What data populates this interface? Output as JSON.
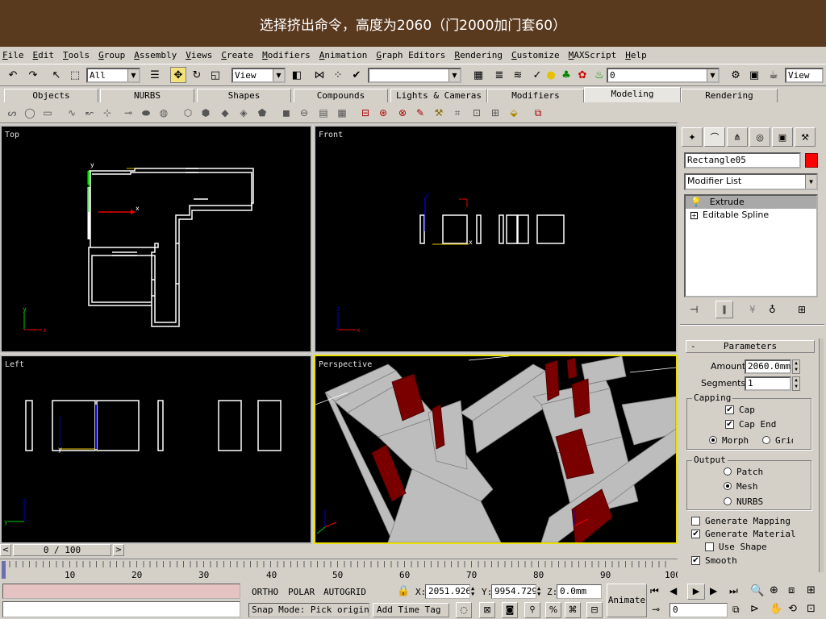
{
  "banner": {
    "text": "选择挤出命令，高度为2060（门2000加门套60）"
  },
  "menu": [
    "File",
    "Edit",
    "Tools",
    "Group",
    "Assembly",
    "Views",
    "Create",
    "Modifiers",
    "Animation",
    "Graph Editors",
    "Rendering",
    "Customize",
    "MAXScript",
    "Help"
  ],
  "toolbar": {
    "selection_filter": "All",
    "ref_coord": "View",
    "named_selection": "",
    "layer": "0",
    "view_right": "View"
  },
  "tabs": [
    "Objects",
    "NURBS",
    "Shapes",
    "Compounds",
    "Lights & Cameras",
    "Modifiers",
    "Modeling",
    "Rendering"
  ],
  "active_tab": "Modeling",
  "viewports": {
    "top": "Top",
    "front": "Front",
    "left": "Left",
    "perspective": "Perspective"
  },
  "command_panel": {
    "object_name": "Rectangle05",
    "object_color": "#ff0000",
    "modifier_list": "Modifier List",
    "stack": [
      "Extrude",
      "Editable Spline"
    ],
    "rollout_title": "Parameters",
    "amount_label": "Amount:",
    "amount_value": "2060.0mm",
    "segments_label": "Segments:",
    "segments_value": "1",
    "capping_title": "Capping",
    "cap_start": "Cap",
    "cap_end": "Cap End",
    "morph": "Morph",
    "grid": "Grid",
    "output_title": "Output",
    "patch": "Patch",
    "mesh": "Mesh",
    "nurbs": "NURBS",
    "gen_mapping": "Generate Mapping",
    "gen_material": "Generate Material",
    "use_shape": "Use Shape",
    "smooth": "Smooth"
  },
  "timeline": {
    "frame": "0 / 100",
    "ticks": [
      "10",
      "20",
      "30",
      "40",
      "50",
      "60",
      "70",
      "80",
      "90",
      "100"
    ]
  },
  "status": {
    "ortho": "ORTHO",
    "polar": "POLAR",
    "autogrid": "AUTOGRID",
    "x_label": "X:",
    "x_value": "2051.926",
    "y_label": "Y:",
    "y_value": "9954.729",
    "z_label": "Z:",
    "z_value": "0.0mm",
    "snap_mode": "Snap Mode: Pick origin",
    "add_time_tag": "Add Time Tag",
    "animate": "Animate",
    "frame_value": "0"
  }
}
